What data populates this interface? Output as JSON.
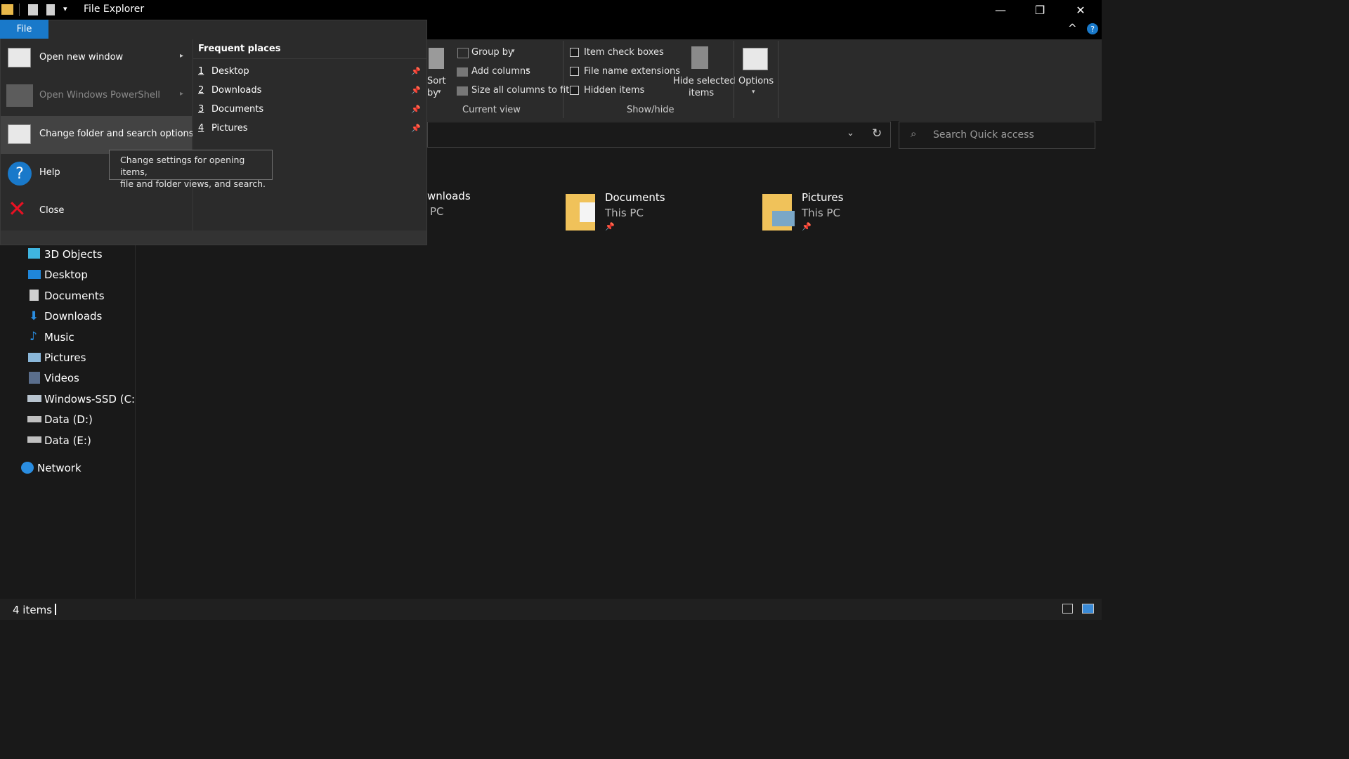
{
  "window": {
    "title": "File Explorer",
    "controls": {
      "minimize": "—",
      "restore": "❐",
      "close": "✕"
    },
    "ribbon_collapse": "^",
    "help": "?"
  },
  "file_tab": {
    "label": "File"
  },
  "ribbon": {
    "sort_by": {
      "line1": "Sort",
      "line2": "by"
    },
    "current_view": {
      "label": "Current view",
      "group_by": "Group by",
      "add_columns": "Add columns",
      "size_all_columns": "Size all columns to fit"
    },
    "show_hide": {
      "label": "Show/hide",
      "item_check_boxes": "Item check boxes",
      "file_name_extensions": "File name extensions",
      "hidden_items": "Hidden items",
      "hide_selected": {
        "line1": "Hide selected",
        "line2": "items"
      }
    },
    "options": "Options"
  },
  "search": {
    "placeholder": "Search Quick access"
  },
  "file_menu": {
    "items": [
      {
        "label": "Open new window",
        "has_arrow": true
      },
      {
        "label": "Open Windows PowerShell",
        "has_arrow": true,
        "disabled": true
      },
      {
        "label": "Change folder and search options",
        "selected": true
      },
      {
        "label": "Help"
      },
      {
        "label": "Close"
      }
    ],
    "frequent_header": "Frequent places",
    "frequent": [
      {
        "num": "1",
        "label": "Desktop"
      },
      {
        "num": "2",
        "label": "Downloads"
      },
      {
        "num": "3",
        "label": "Documents"
      },
      {
        "num": "4",
        "label": "Pictures"
      }
    ],
    "tooltip": {
      "line1": "Change settings for opening items,",
      "line2": "file and folder views, and search."
    }
  },
  "sidebar": {
    "items": [
      {
        "label": "3D Objects"
      },
      {
        "label": "Desktop"
      },
      {
        "label": "Documents"
      },
      {
        "label": "Downloads"
      },
      {
        "label": "Music"
      },
      {
        "label": "Pictures"
      },
      {
        "label": "Videos"
      },
      {
        "label": "Windows-SSD (C:)"
      },
      {
        "label": "Data (D:)"
      },
      {
        "label": "Data (E:)"
      }
    ],
    "network": "Network"
  },
  "content": {
    "items": [
      {
        "title": "wnloads",
        "sub": "PC"
      },
      {
        "title": "Documents",
        "sub": "This PC"
      },
      {
        "title": "Pictures",
        "sub": "This PC"
      }
    ]
  },
  "status": {
    "count": "4 items"
  }
}
